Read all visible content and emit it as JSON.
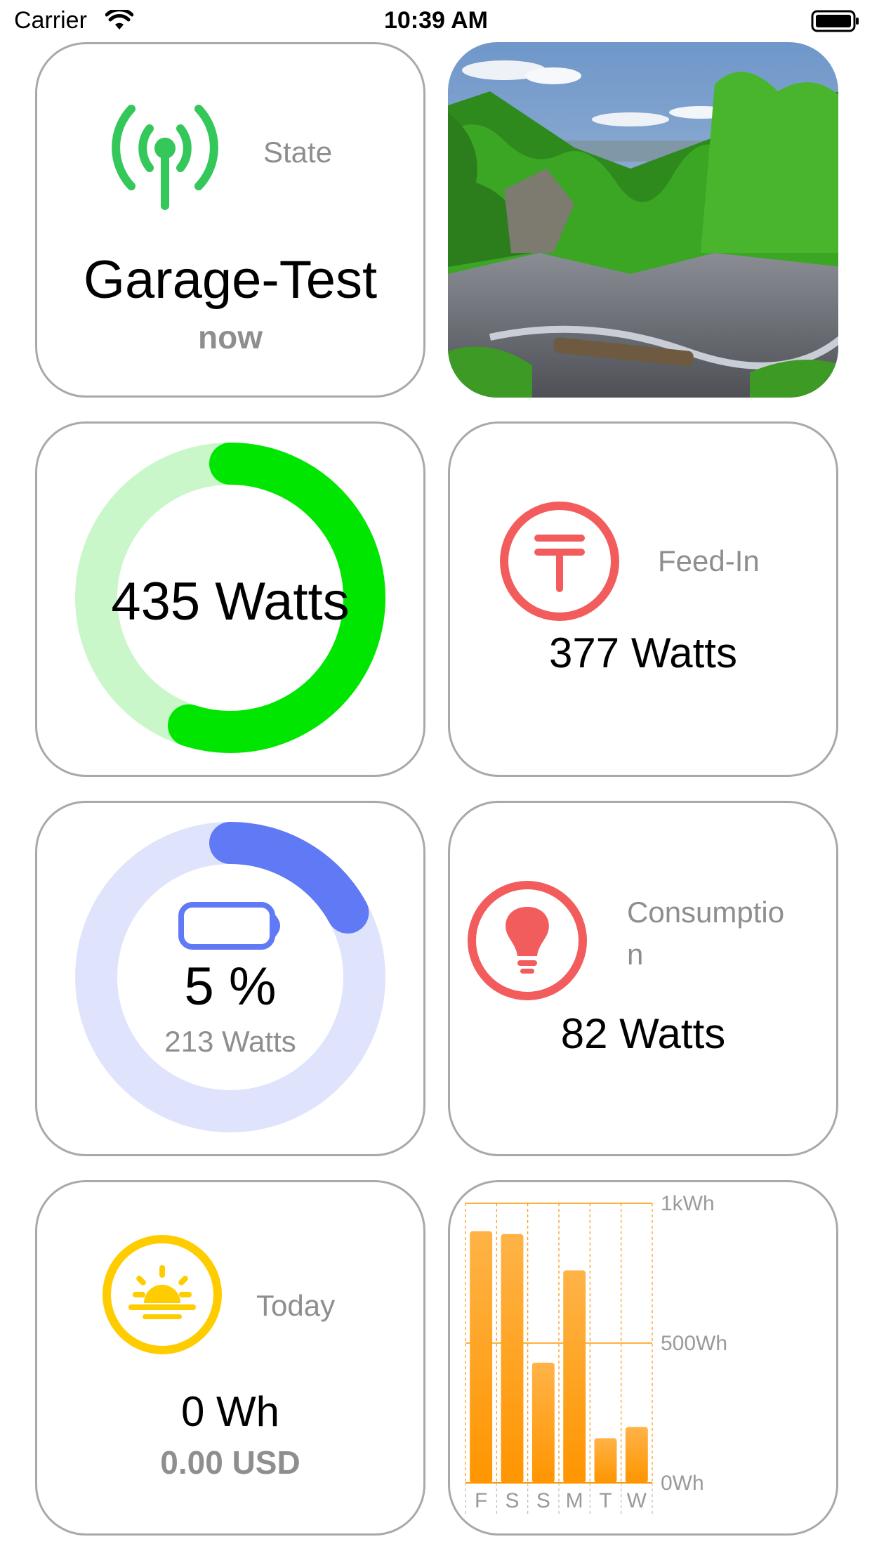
{
  "status_bar": {
    "carrier": "Carrier",
    "time": "10:39 AM"
  },
  "state_card": {
    "label": "State",
    "device_name": "Garage-Test",
    "updated": "now",
    "icon": "antenna-signal-icon",
    "icon_color": "#34c759"
  },
  "photo_card": {
    "description_icon": "landscape-photo"
  },
  "production_card": {
    "value_text": "435 Watts",
    "ring_fraction": 0.55,
    "ring_color": "#00e600",
    "ring_track_color": "#c9f7c9"
  },
  "feed_in_card": {
    "label": "Feed-In",
    "value_text": "377 Watts",
    "icon": "grid-tower-icon",
    "icon_color": "#f25c5c"
  },
  "battery_card": {
    "percent_text": "5 %",
    "watts_text": "213 Watts",
    "ring_fraction": 0.17,
    "ring_color": "#6079f5",
    "ring_track_color": "#dfe4fc",
    "icon": "battery-icon"
  },
  "consumption_card": {
    "label_line1": "Consumptio",
    "label_line2": "n",
    "value_text": "82 Watts",
    "icon": "lightbulb-icon",
    "icon_color": "#f25c5c"
  },
  "today_card": {
    "label": "Today",
    "energy_text": "0 Wh",
    "money_text": "0.00 USD",
    "icon": "sunrise-icon",
    "icon_color": "#ffcc00"
  },
  "chart_data": {
    "type": "bar",
    "categories": [
      "F",
      "S",
      "S",
      "M",
      "T",
      "W"
    ],
    "values": [
      900,
      890,
      430,
      760,
      160,
      200
    ],
    "ylim": [
      0,
      1000
    ],
    "y_tick_labels": [
      "1kWh",
      "500Wh",
      "0Wh"
    ],
    "y_tick_values": [
      1000,
      500,
      0
    ],
    "bar_color_top": "#ffb347",
    "bar_color_bottom": "#ff9500",
    "grid": true,
    "title": "",
    "xlabel": "",
    "ylabel": ""
  }
}
